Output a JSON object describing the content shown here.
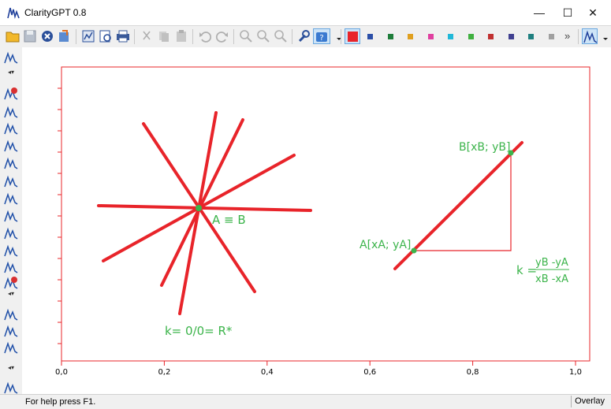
{
  "window": {
    "title": "ClarityGPT 0.8",
    "minimize_glyph": "—",
    "maximize_glyph": "☐",
    "close_glyph": "✕"
  },
  "toolbar": {
    "more_glyph": "»",
    "swatch_colors": [
      "#2b4fa8",
      "#1e7d3a",
      "#e0a020",
      "#e040a0",
      "#20b8d8",
      "#40b040",
      "#c03030",
      "#404090",
      "#208080",
      "#a0a0a0"
    ],
    "active_color": "#e8242a"
  },
  "sidebar": {
    "scroll_glyph": "◂▾"
  },
  "plot": {
    "x_ticks": [
      "0,0",
      "0,2",
      "0,4",
      "0,6",
      "0,8",
      "1,0"
    ],
    "label_a_equiv_b": "A ≡ B",
    "label_k_zero": "k= 0/0= R*",
    "label_b": "B[xB; yB]",
    "label_a": "A[xA; yA]",
    "k_prefix": "k =",
    "k_numerator": "yB -yA",
    "k_denominator": "xB -xA",
    "line_color": "#e8242a",
    "point_color": "#3cb44b"
  },
  "status": {
    "help_text": "For help press F1.",
    "mode": "Overlay"
  }
}
